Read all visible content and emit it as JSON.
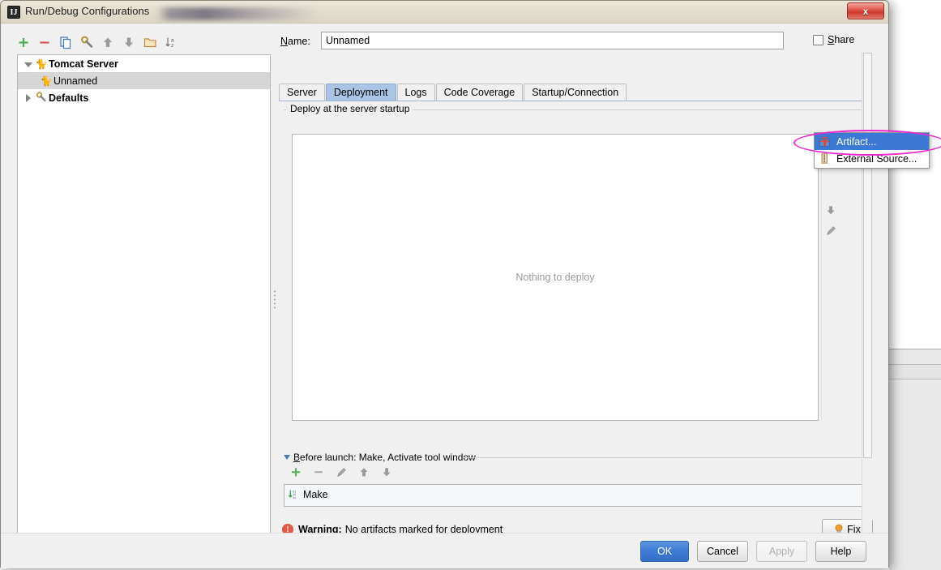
{
  "window": {
    "title": "Run/Debug Configurations",
    "title_icon": "intellij-idea-icon",
    "close_label": "x"
  },
  "tree_toolbar": {
    "items": [
      {
        "name": "add-configuration-button",
        "icon": "plus-icon"
      },
      {
        "name": "remove-configuration-button",
        "icon": "minus-icon"
      },
      {
        "name": "copy-configuration-button",
        "icon": "copy-icon"
      },
      {
        "name": "edit-defaults-button",
        "icon": "wrench-icon"
      },
      {
        "name": "move-up-button",
        "icon": "arrow-up-icon"
      },
      {
        "name": "move-down-button",
        "icon": "arrow-down-icon"
      },
      {
        "name": "create-folder-button",
        "icon": "folder-icon"
      },
      {
        "name": "sort-configurations-button",
        "icon": "sort-alpha-icon"
      }
    ]
  },
  "tree": {
    "nodes": [
      {
        "label": "Tomcat Server",
        "icon": "tomcat-icon",
        "bold": true,
        "expanded": true,
        "selected": false,
        "indent": 0
      },
      {
        "label": "Unnamed",
        "icon": "tomcat-icon",
        "bold": false,
        "expanded": null,
        "selected": true,
        "indent": 1
      },
      {
        "label": "Defaults",
        "icon": "wrench-icon",
        "bold": true,
        "expanded": false,
        "selected": false,
        "indent": 0
      }
    ]
  },
  "name_field": {
    "label": "Name:",
    "label_mnemonic": "N",
    "value": "Unnamed",
    "placeholder": "Unnamed"
  },
  "share": {
    "label": "Share",
    "mnemonic": "S",
    "checked": false
  },
  "tabs": [
    {
      "label": "Server",
      "active": false
    },
    {
      "label": "Deployment",
      "active": true
    },
    {
      "label": "Logs",
      "active": false
    },
    {
      "label": "Code Coverage",
      "active": false
    },
    {
      "label": "Startup/Connection",
      "active": false
    }
  ],
  "deployment": {
    "group_title": "Deploy at the server startup",
    "empty_text": "Nothing to deploy",
    "side_tools": [
      {
        "name": "add-deployment-button",
        "icon": "plus-icon"
      },
      {
        "name": "move-down-deployment-button",
        "icon": "arrow-down-icon"
      },
      {
        "name": "edit-deployment-button",
        "icon": "pencil-icon"
      }
    ]
  },
  "popup_menu": {
    "items": [
      {
        "label": "Artifact...",
        "icon": "artifact-icon",
        "highlighted": true
      },
      {
        "label": "External Source...",
        "icon": "external-source-icon",
        "highlighted": false
      }
    ],
    "annotation": {
      "shape": "ellipse",
      "color": "#ea2ad0"
    }
  },
  "before_launch": {
    "title": "Before launch: Make, Activate tool window",
    "title_mnemonic": "B",
    "toolbar": [
      {
        "name": "add-task-button",
        "icon": "plus-icon"
      },
      {
        "name": "remove-task-button",
        "icon": "minus-icon"
      },
      {
        "name": "edit-task-button",
        "icon": "pencil-icon"
      },
      {
        "name": "task-move-up-button",
        "icon": "arrow-up-icon"
      },
      {
        "name": "task-move-down-button",
        "icon": "arrow-down-icon"
      }
    ],
    "tasks": [
      {
        "label": "Make",
        "icon": "make-icon"
      }
    ]
  },
  "warning": {
    "prefix": "Warning:",
    "message": "No artifacts marked for deployment",
    "icon": "warning-icon",
    "fix_label": "Fix",
    "fix_icon": "lightbulb-icon",
    "color": "#e05a48"
  },
  "footer": {
    "ok": "OK",
    "cancel": "Cancel",
    "apply": "Apply",
    "apply_disabled": true,
    "help": "Help"
  },
  "colors": {
    "accent": "#3b79d4",
    "tab_active": "#a9c4e4",
    "annotation": "#ea2ad0",
    "warning": "#e05a48",
    "primary_button": "#3c7ad4"
  }
}
